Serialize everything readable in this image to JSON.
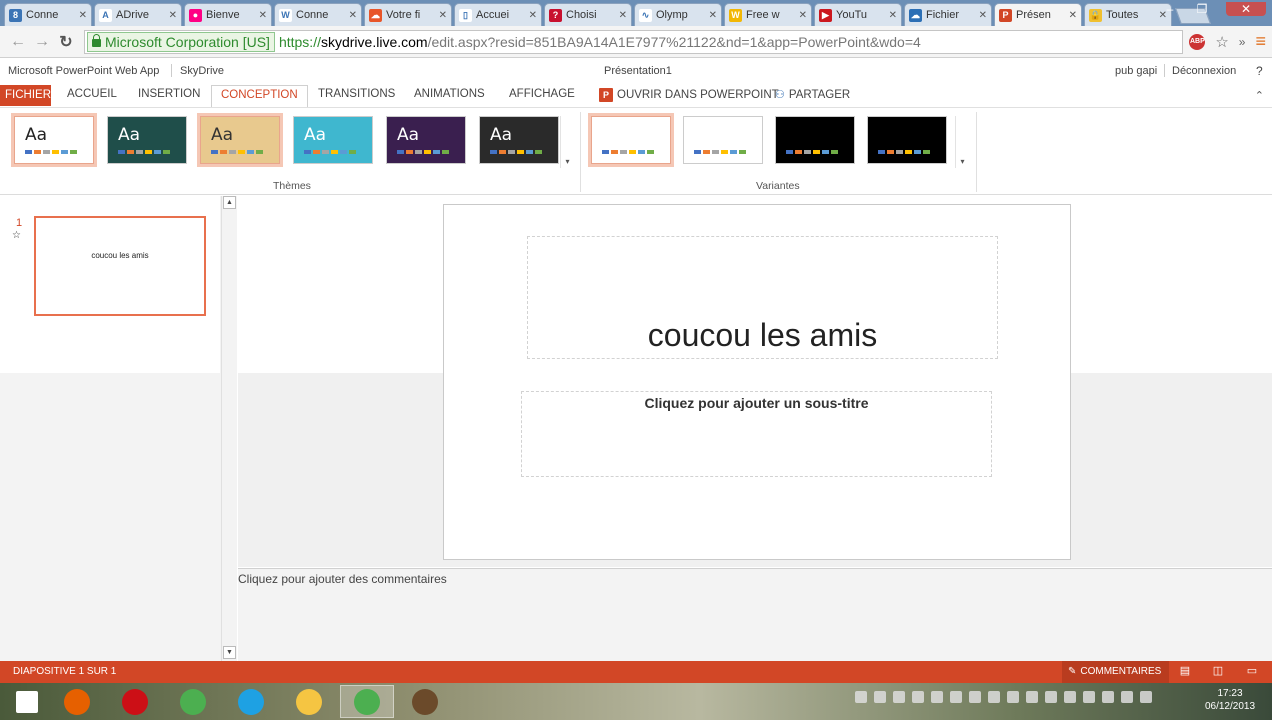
{
  "browser": {
    "tabs": [
      {
        "label": "Conne",
        "fav_color": "#3b74b5",
        "fav_glyph": "8",
        "active": false
      },
      {
        "label": "ADrive",
        "fav_color": "#ffffff",
        "fav_glyph": "A",
        "active": false
      },
      {
        "label": "Bienve",
        "fav_color": "#ff0084",
        "fav_glyph": "●",
        "active": false
      },
      {
        "label": "Conne",
        "fav_color": "#ffffff",
        "fav_glyph": "W",
        "active": false
      },
      {
        "label": "Votre fi",
        "fav_color": "#e8562a",
        "fav_glyph": "☁",
        "active": false
      },
      {
        "label": "Accuei",
        "fav_color": "#ffffff",
        "fav_glyph": "▯",
        "active": false
      },
      {
        "label": "Choisi",
        "fav_color": "#c8102e",
        "fav_glyph": "?",
        "active": false
      },
      {
        "label": "Olymp",
        "fav_color": "#ffffff",
        "fav_glyph": "∿",
        "active": false
      },
      {
        "label": "Free w",
        "fav_color": "#f2b705",
        "fav_glyph": "W",
        "active": false
      },
      {
        "label": "YouTu",
        "fav_color": "#cc181e",
        "fav_glyph": "▶",
        "active": false
      },
      {
        "label": "Fichier",
        "fav_color": "#2c6fb5",
        "fav_glyph": "☁",
        "active": false
      },
      {
        "label": "Présen",
        "fav_color": "#d24726",
        "fav_glyph": "P",
        "active": true
      },
      {
        "label": "Toutes",
        "fav_color": "#f0c030",
        "fav_glyph": "🔒",
        "active": false
      }
    ],
    "ev_label": "Microsoft Corporation [US]",
    "url_scheme": "https://",
    "url_host": "skydrive.live.com",
    "url_path": "/edit.aspx?resid=851BA9A14A1E7977%21122&nd=1&app=PowerPoint&wdo=4",
    "adblock_label": "ABP"
  },
  "app": {
    "app_name": "Microsoft PowerPoint Web App",
    "service": "SkyDrive",
    "doc_title": "Présentation1",
    "user": "pub gapi",
    "logout": "Déconnexion",
    "help": "?"
  },
  "ribbon": {
    "file_tab": "FICHIER",
    "tabs": [
      "ACCUEIL",
      "INSERTION",
      "CONCEPTION",
      "TRANSITIONS",
      "ANIMATIONS",
      "AFFICHAGE"
    ],
    "active_tab": "CONCEPTION",
    "open_in_ppt": "OUVRIR DANS POWERPOINT",
    "share": "PARTAGER",
    "themes_label": "Thèmes",
    "variants_label": "Variantes",
    "theme_sample": "Aa",
    "themes": [
      {
        "bg": "#ffffff",
        "fg": "#222222",
        "selected": true
      },
      {
        "bg": "#1f4e4a",
        "fg": "#ffffff",
        "selected": false
      },
      {
        "bg": "#e8c98e",
        "fg": "#333333",
        "selected": true
      },
      {
        "bg": "#3fb7cf",
        "fg": "#ffffff",
        "selected": false
      },
      {
        "bg": "#3a1f4f",
        "fg": "#ffffff",
        "selected": false
      },
      {
        "bg": "#2a2a2a",
        "fg": "#ffffff",
        "selected": false
      }
    ],
    "variants": [
      {
        "bg": "#ffffff",
        "selected": true
      },
      {
        "bg": "#ffffff",
        "selected": false
      },
      {
        "bg": "#000000",
        "selected": false
      },
      {
        "bg": "#000000",
        "selected": false
      }
    ],
    "swatch_colors": [
      "#4472c4",
      "#ed7d31",
      "#a5a5a5",
      "#ffc000",
      "#5b9bd5",
      "#70ad47"
    ]
  },
  "slides_pane": {
    "slide_number": "1",
    "slide_thumb_text": "coucou les amis"
  },
  "slide": {
    "title": "coucou les amis",
    "subtitle_placeholder": "Cliquez pour ajouter un sous-titre"
  },
  "notes": {
    "placeholder": "Cliquez pour ajouter des commentaires"
  },
  "status": {
    "slide_info": "DIAPOSITIVE 1 SUR 1",
    "comments": "COMMENTAIRES"
  },
  "taskbar": {
    "apps": [
      {
        "name": "start",
        "color": "#ffffff"
      },
      {
        "name": "firefox",
        "color": "#e66000"
      },
      {
        "name": "opera",
        "color": "#cc0f16"
      },
      {
        "name": "chrome",
        "color": "#4caf50"
      },
      {
        "name": "internet-explorer",
        "color": "#1ea1e3"
      },
      {
        "name": "file-explorer",
        "color": "#f5c542"
      },
      {
        "name": "chrome-active",
        "color": "#4caf50"
      },
      {
        "name": "media-app",
        "color": "#6b4a2a"
      }
    ],
    "time": "17:23",
    "date": "06/12/2013"
  }
}
